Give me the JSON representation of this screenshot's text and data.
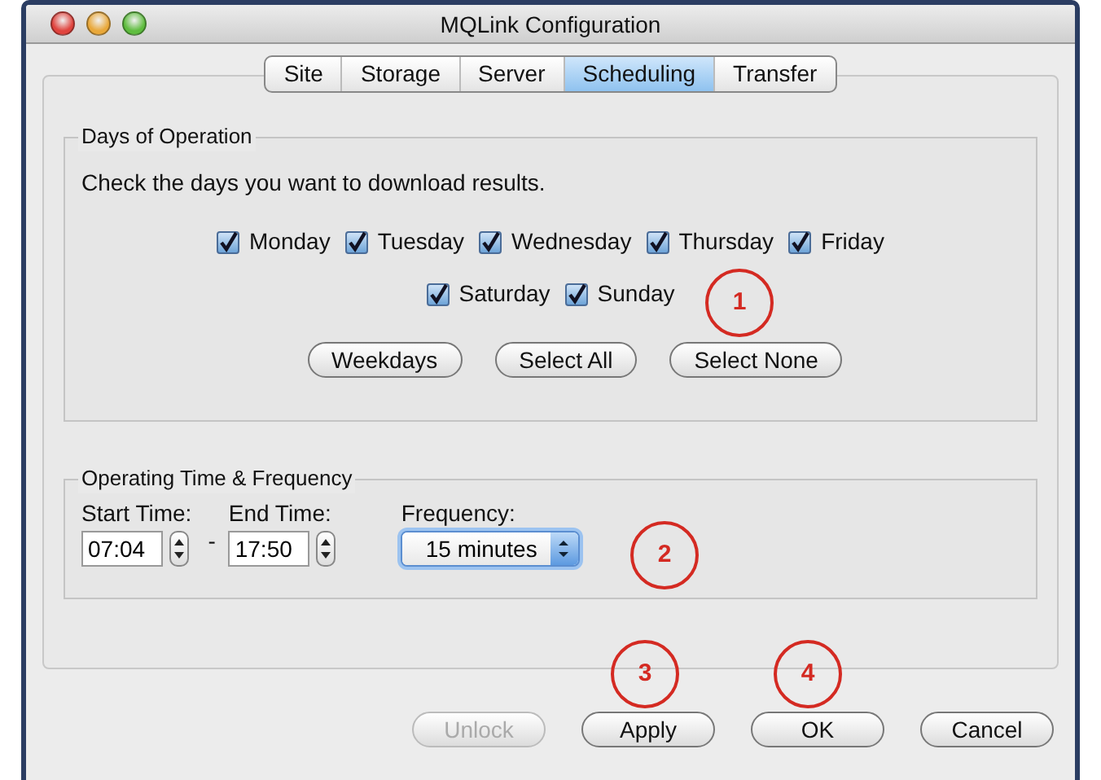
{
  "window": {
    "title": "MQLink Configuration"
  },
  "tabs": [
    {
      "label": "Site",
      "selected": false
    },
    {
      "label": "Storage",
      "selected": false
    },
    {
      "label": "Server",
      "selected": false
    },
    {
      "label": "Scheduling",
      "selected": true
    },
    {
      "label": "Transfer",
      "selected": false
    }
  ],
  "days_group": {
    "title": "Days of Operation",
    "instruction": "Check the days you want to download results.",
    "day_rows": [
      [
        {
          "label": "Monday",
          "checked": true
        },
        {
          "label": "Tuesday",
          "checked": true
        },
        {
          "label": "Wednesday",
          "checked": true
        },
        {
          "label": "Thursday",
          "checked": true
        },
        {
          "label": "Friday",
          "checked": true
        }
      ],
      [
        {
          "label": "Saturday",
          "checked": true
        },
        {
          "label": "Sunday",
          "checked": true
        }
      ]
    ],
    "buttons": [
      "Weekdays",
      "Select All",
      "Select None"
    ]
  },
  "time_group": {
    "title": "Operating Time & Frequency",
    "start_label": "Start Time:",
    "start_value": "07:04",
    "separator": "-",
    "end_label": "End Time:",
    "end_value": "17:50",
    "frequency_label": "Frequency:",
    "frequency_value": "15 minutes"
  },
  "buttons": [
    {
      "label": "Unlock",
      "disabled": true
    },
    {
      "label": "Apply",
      "disabled": false
    },
    {
      "label": "OK",
      "disabled": false
    },
    {
      "label": "Cancel",
      "disabled": false
    }
  ],
  "annotations": [
    {
      "number": "1"
    },
    {
      "number": "2"
    },
    {
      "number": "3"
    },
    {
      "number": "4"
    }
  ]
}
